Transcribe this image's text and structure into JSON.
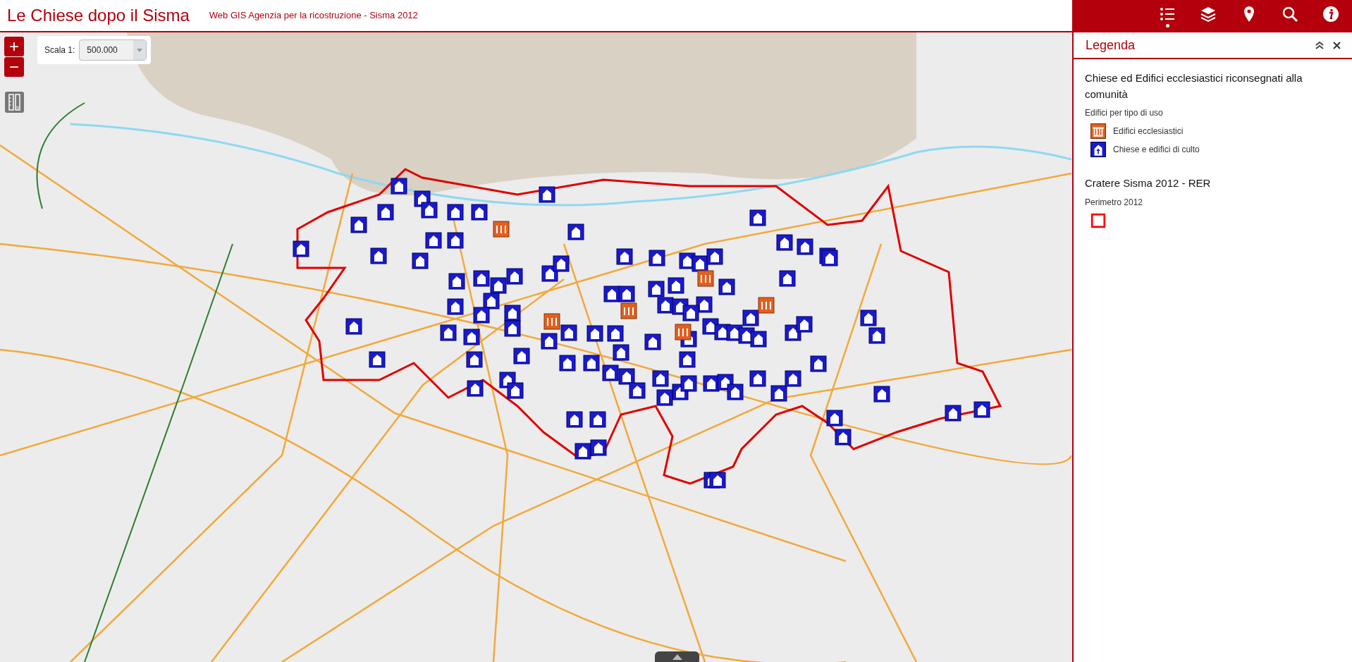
{
  "header": {
    "title": "Le Chiese dopo il Sisma",
    "subtitle": "Web GIS Agenzia per la ricostruzione - Sisma 2012"
  },
  "toolbar": [
    {
      "kind": "legend",
      "selected": true
    },
    {
      "kind": "layers",
      "selected": false
    },
    {
      "kind": "locate",
      "selected": false
    },
    {
      "kind": "search",
      "selected": false
    },
    {
      "kind": "info",
      "selected": false
    }
  ],
  "zoom": {
    "in": "+",
    "out": "−"
  },
  "scale": {
    "label": "Scala 1:",
    "value": "500.000"
  },
  "legend_panel": {
    "title": "Legenda",
    "layers": [
      {
        "title": "Chiese ed Edifici ecclesiastici riconsegnati alla comunità",
        "group": "Edifici per tipo di uso",
        "items": [
          {
            "kind": "ecclesiastical",
            "label": "Edifici ecclesiastici"
          },
          {
            "kind": "church",
            "label": "Chiese e edifici di culto"
          }
        ]
      },
      {
        "title": "Cratere Sisma 2012 - RER",
        "group": "Perimetro 2012",
        "items": [
          {
            "kind": "perimeter"
          }
        ]
      }
    ]
  }
}
